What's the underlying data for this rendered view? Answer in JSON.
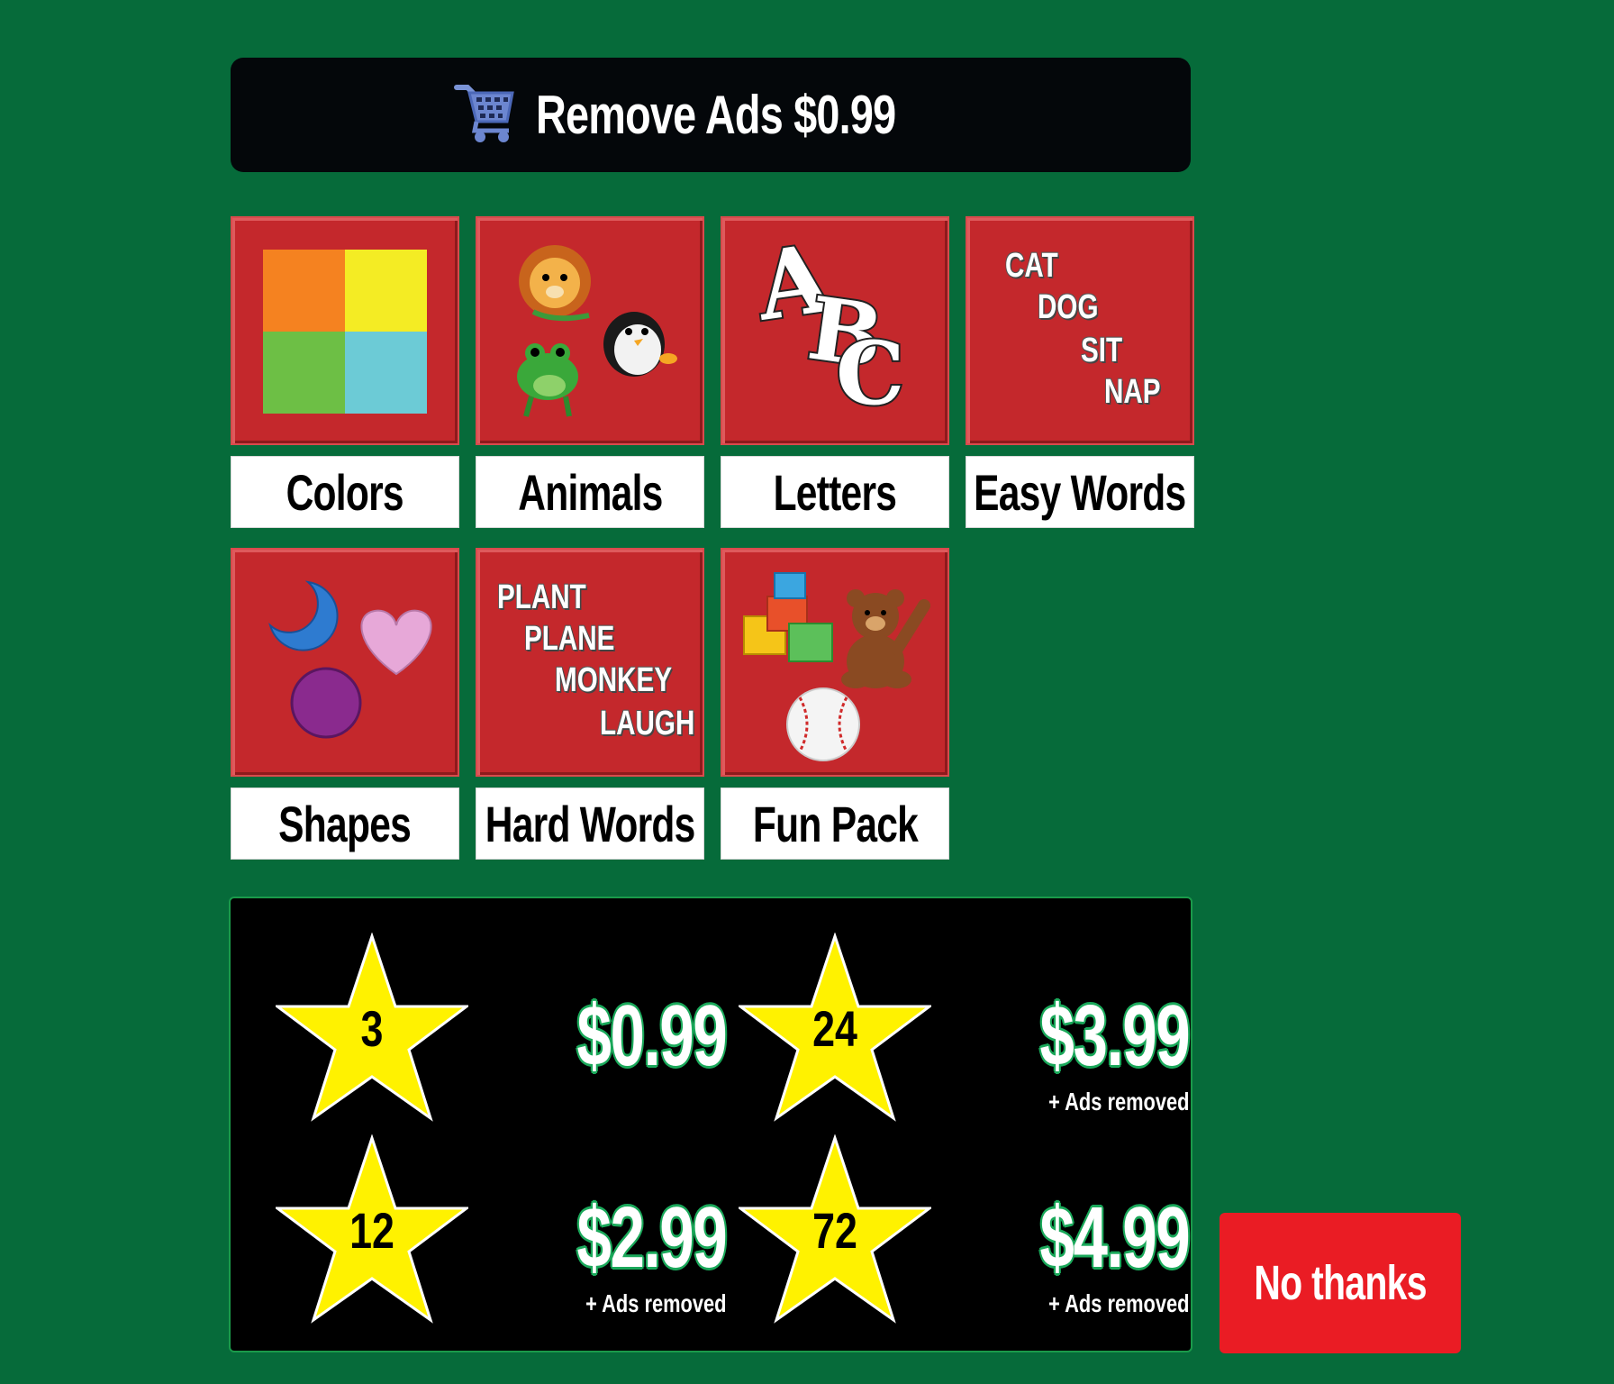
{
  "remove_ads": {
    "label": "Remove Ads $0.99",
    "icon": "shopping-cart-icon"
  },
  "categories": [
    {
      "id": "colors",
      "label": "Colors",
      "icon": "color-squares-icon"
    },
    {
      "id": "animals",
      "label": "Animals",
      "icon": "animals-icon"
    },
    {
      "id": "letters",
      "label": "Letters",
      "icon": "abc-letters-icon",
      "art_text": "ABC"
    },
    {
      "id": "easy-words",
      "label": "Easy Words",
      "icon": "easy-words-icon",
      "words": [
        "CAT",
        "DOG",
        "SIT",
        "NAP"
      ]
    },
    {
      "id": "shapes",
      "label": "Shapes",
      "icon": "shapes-icon"
    },
    {
      "id": "hard-words",
      "label": "Hard Words",
      "icon": "hard-words-icon",
      "words": [
        "PLANT",
        "PLANE",
        "MONKEY",
        "LAUGH"
      ]
    },
    {
      "id": "fun-pack",
      "label": "Fun Pack",
      "icon": "toys-icon"
    }
  ],
  "packs": [
    {
      "stars": "3",
      "price": "$0.99",
      "extra": ""
    },
    {
      "stars": "24",
      "price": "$3.99",
      "extra": "+ Ads removed"
    },
    {
      "stars": "12",
      "price": "$2.99",
      "extra": "+ Ads removed"
    },
    {
      "stars": "72",
      "price": "$4.99",
      "extra": "+ Ads removed"
    }
  ],
  "no_thanks": {
    "label": "No thanks"
  },
  "colors": {
    "background": "#066b3a",
    "tile": "#c4282c",
    "star": "#fff200",
    "price_outline": "#1aa85a",
    "no_thanks": "#ea1c24"
  }
}
